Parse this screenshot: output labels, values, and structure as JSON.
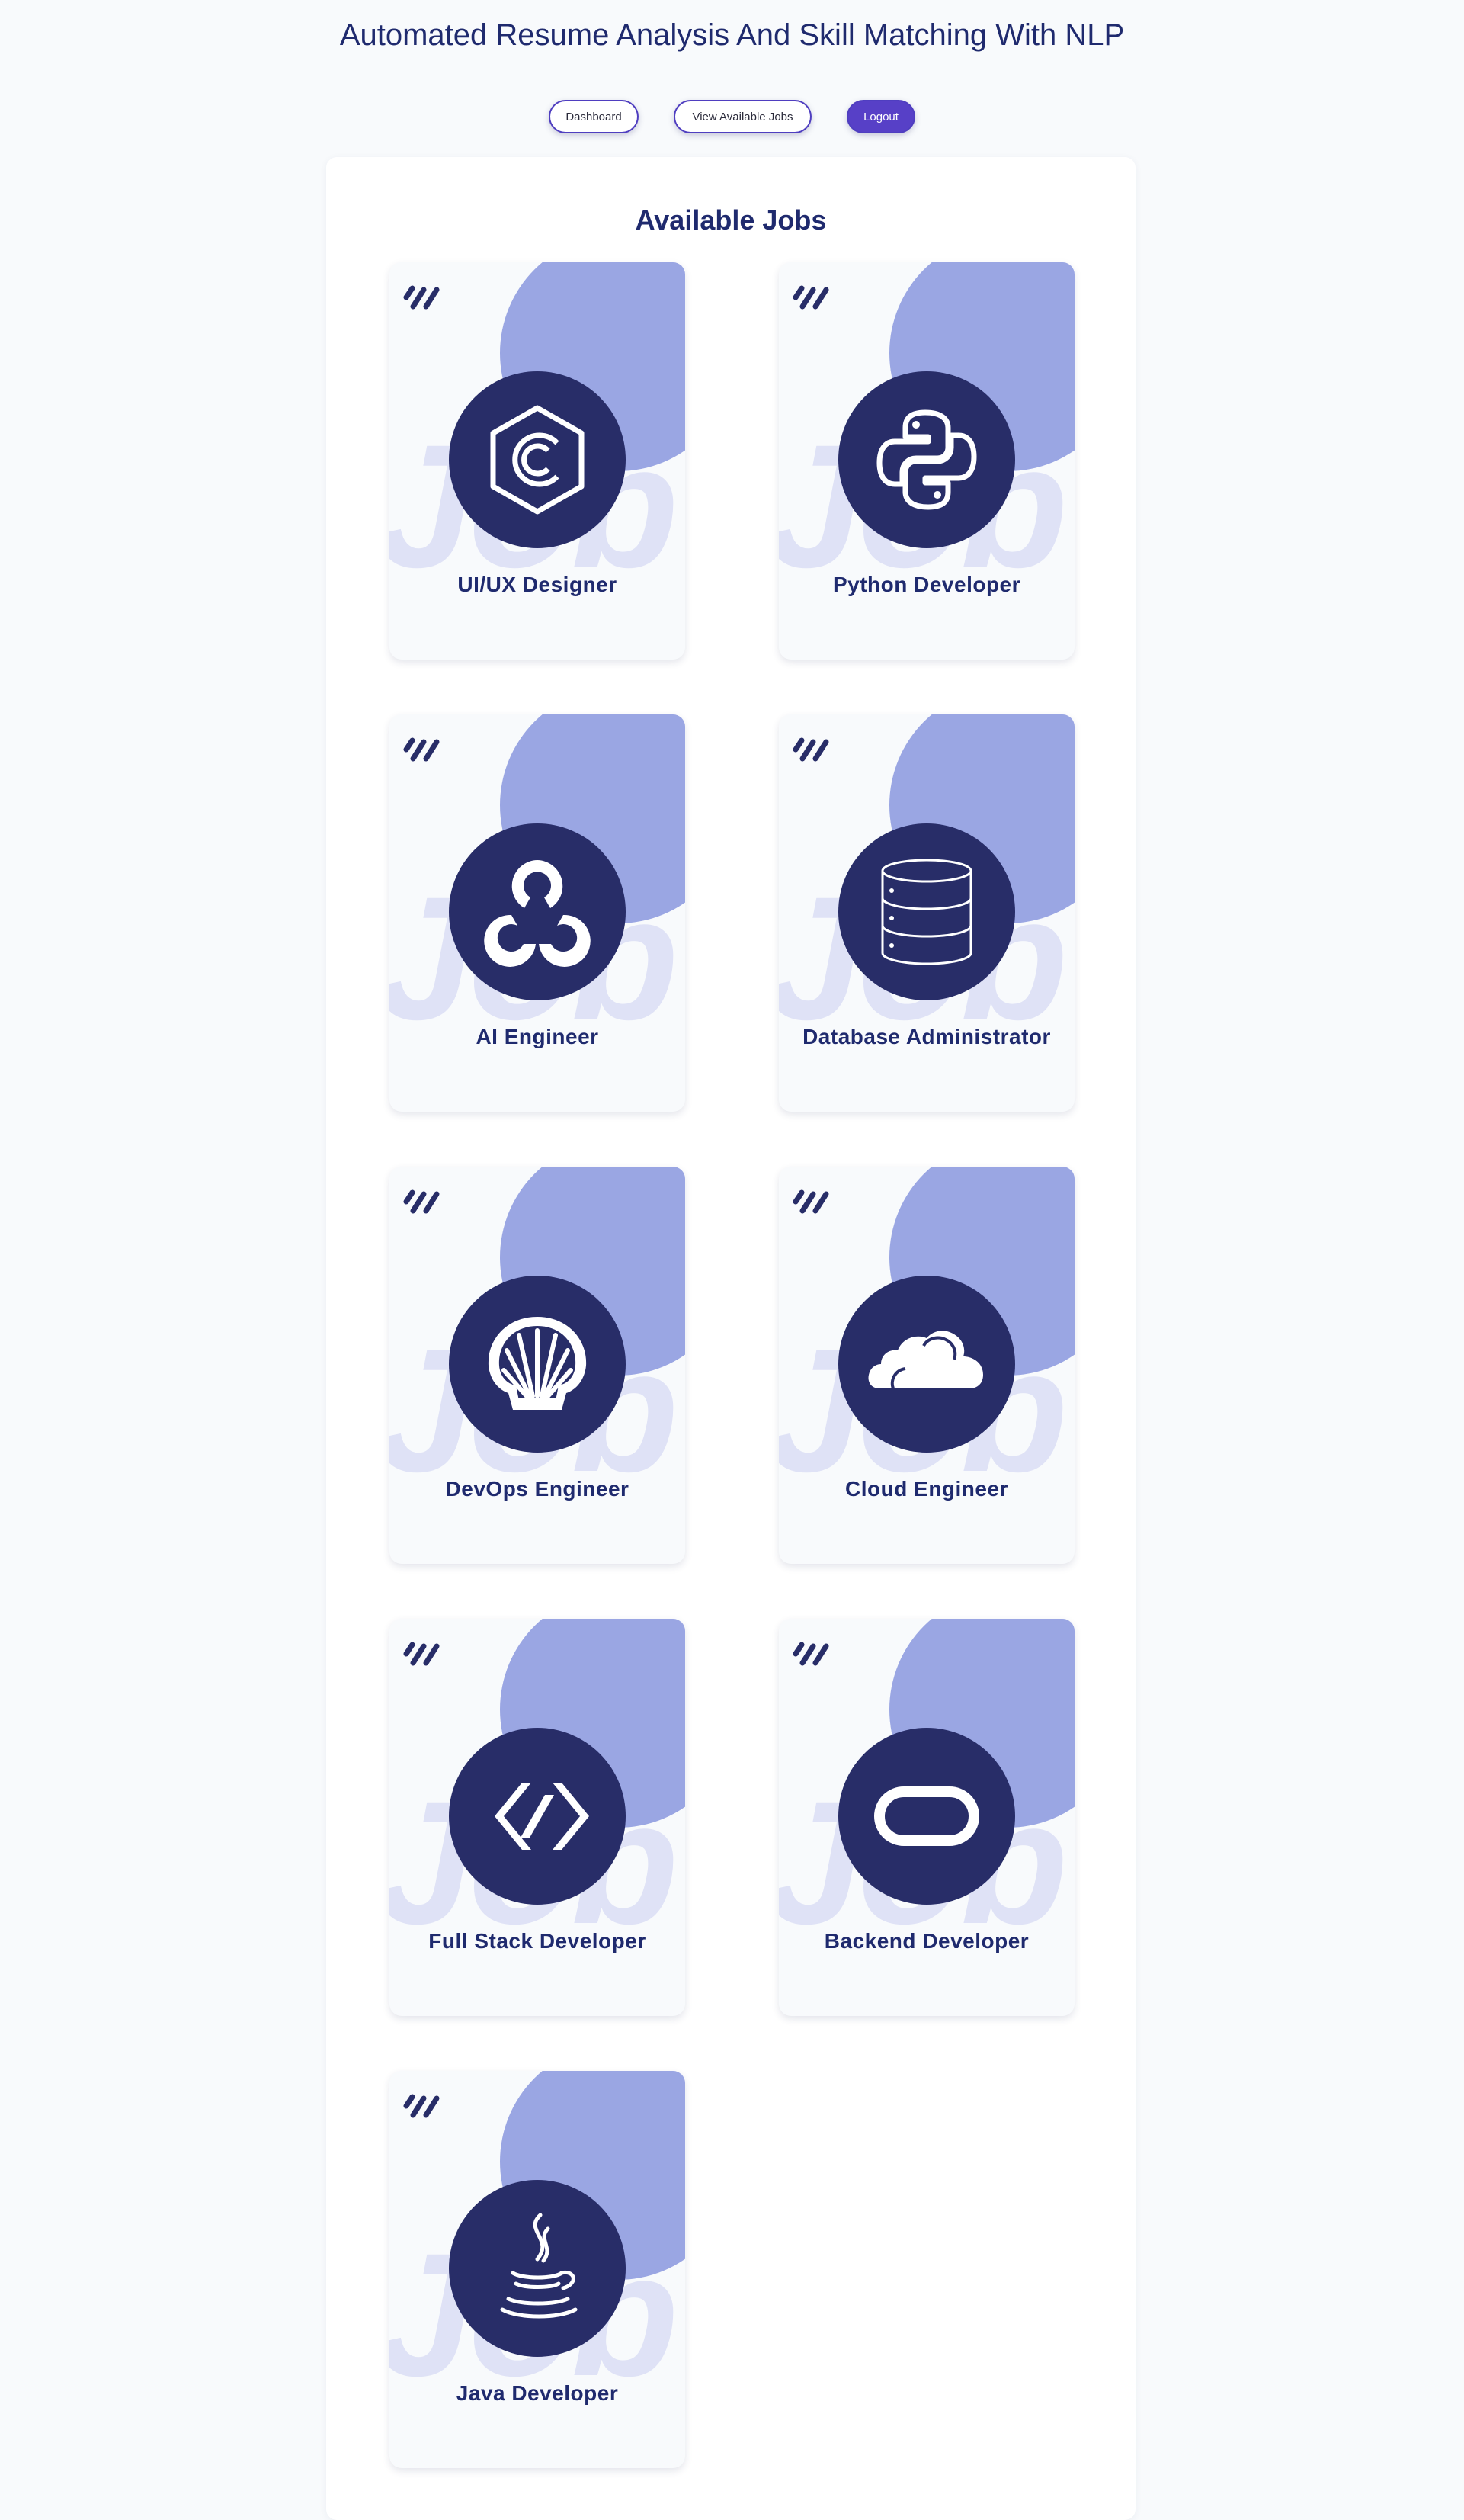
{
  "header": {
    "title": "Automated Resume Analysis And Skill Matching With NLP"
  },
  "nav": {
    "dashboard": "Dashboard",
    "view_jobs": "View Available Jobs",
    "logout": "Logout"
  },
  "section": {
    "title": "Available Jobs"
  },
  "jobs": [
    {
      "title": "UI/UX Designer",
      "icon": "hexagon-c-icon",
      "watermark": "Job"
    },
    {
      "title": "Python Developer",
      "icon": "python-icon",
      "watermark": "Job"
    },
    {
      "title": "AI Engineer",
      "icon": "opencv-icon",
      "watermark": "Job"
    },
    {
      "title": "Database Administrator",
      "icon": "database-icon",
      "watermark": "Job"
    },
    {
      "title": "DevOps Engineer",
      "icon": "shell-icon",
      "watermark": "Job"
    },
    {
      "title": "Cloud Engineer",
      "icon": "cloud-icon",
      "watermark": "Job"
    },
    {
      "title": "Full Stack Developer",
      "icon": "code-brackets-icon",
      "watermark": "Job"
    },
    {
      "title": "Backend Developer",
      "icon": "oracle-icon",
      "watermark": "Job"
    },
    {
      "title": "Java Developer",
      "icon": "java-icon",
      "watermark": "Job"
    }
  ],
  "colors": {
    "primary": "#1f2a6e",
    "icon_circle": "#282d68",
    "blob": "#9aa6e3",
    "watermark": "#dfe2f6",
    "button_accent": "#5740c7",
    "page_bg": "#f8fafc"
  }
}
